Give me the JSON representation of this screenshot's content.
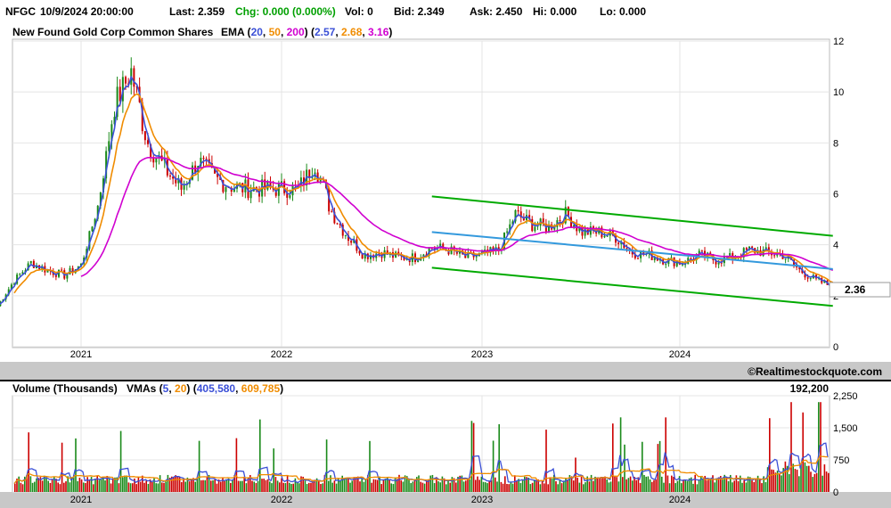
{
  "quote": {
    "symbol": "NFGC",
    "datetime": "10/9/2024 20:00:00",
    "last": "Last: 2.359",
    "chg": "Chg: 0.000 (0.000%)",
    "vol": "Vol: 0",
    "bid": "Bid: 2.349",
    "ask": "Ask: 2.450",
    "hi": "Hi: 0.000",
    "lo": "Lo: 0.000"
  },
  "colors": {
    "up": "#1a8a1a",
    "down": "#cc0000",
    "ema20": "#3a4fd6",
    "ema50": "#f08c00",
    "ema200": "#d000d0",
    "channel_green": "#00aa00",
    "channel_blue": "#3399dd",
    "chg": "#00a000",
    "band": "#c8c8c8"
  },
  "copyright": "©Realtimestockquote.com",
  "price_panel": {
    "title": "New Found Gold Corp Common Shares",
    "ema_prefix": "EMA (",
    "ema_periods": [
      "20",
      "50",
      "200"
    ],
    "ema_values": [
      "2.57",
      "2.68",
      "3.16"
    ],
    "last_price_tag": "2.36"
  },
  "volume_panel": {
    "title": "Volume (Thousands)",
    "vma_label": "VMAs (",
    "vma_periods": [
      "5",
      "20"
    ],
    "vma_values": [
      "405,580",
      "609,785"
    ],
    "last_volume": "192,200"
  },
  "chart_data": [
    {
      "type": "candlestick",
      "title": "New Found Gold Corp Common Shares",
      "ylim": [
        0,
        12
      ],
      "y_ticks": [
        0,
        2,
        4,
        6,
        8,
        10,
        12
      ],
      "x_ticks": [
        "2021",
        "2022",
        "2023",
        "2024"
      ],
      "grid": true,
      "series": [
        {
          "name": "Price (approx. monthly close)",
          "x": [
            "2020-08",
            "2020-09",
            "2020-10",
            "2020-11",
            "2020-12",
            "2021-01",
            "2021-02",
            "2021-03",
            "2021-04",
            "2021-05",
            "2021-06",
            "2021-07",
            "2021-08",
            "2021-09",
            "2021-10",
            "2021-11",
            "2021-12",
            "2022-01",
            "2022-02",
            "2022-03",
            "2022-04",
            "2022-05",
            "2022-06",
            "2022-07",
            "2022-08",
            "2022-09",
            "2022-10",
            "2022-11",
            "2022-12",
            "2023-01",
            "2023-02",
            "2023-03",
            "2023-04",
            "2023-05",
            "2023-06",
            "2023-07",
            "2023-08",
            "2023-09",
            "2023-10",
            "2023-11",
            "2023-12",
            "2024-01",
            "2024-02",
            "2024-03",
            "2024-04",
            "2024-05",
            "2024-06",
            "2024-07",
            "2024-08",
            "2024-09",
            "2024-10"
          ],
          "values": [
            1.6,
            2.6,
            3.3,
            3.0,
            2.8,
            3.2,
            5.5,
            9.5,
            10.8,
            8.0,
            7.0,
            6.2,
            7.3,
            6.6,
            6.3,
            6.2,
            6.2,
            6.2,
            6.2,
            7.2,
            5.3,
            4.3,
            3.6,
            3.7,
            3.5,
            3.5,
            3.9,
            3.8,
            3.5,
            3.6,
            3.8,
            5.2,
            4.8,
            4.7,
            5.2,
            4.5,
            4.5,
            4.3,
            3.7,
            3.6,
            3.4,
            3.3,
            3.6,
            3.4,
            3.5,
            3.8,
            3.7,
            3.6,
            3.0,
            2.6,
            2.36
          ]
        },
        {
          "name": "EMA 20",
          "x": [
            "2024-10"
          ],
          "values": [
            2.57
          ]
        },
        {
          "name": "EMA 50",
          "x": [
            "2024-10"
          ],
          "values": [
            2.68
          ]
        },
        {
          "name": "EMA 200",
          "x": [
            "2024-10"
          ],
          "values": [
            3.16
          ]
        }
      ],
      "annotations": [
        "Descending channel (green) from late 2022 to Oct 2024",
        "Blue regression midline"
      ]
    },
    {
      "type": "bar",
      "title": "Volume (Thousands)",
      "ylim": [
        0,
        2250
      ],
      "y_ticks": [
        0,
        750,
        1500,
        2250
      ],
      "x_ticks": [
        "2021",
        "2022",
        "2023",
        "2024"
      ],
      "series": [
        {
          "name": "Volume (approx. typical)",
          "x": [
            "2021",
            "2022",
            "2023",
            "2024"
          ],
          "values": [
            300,
            250,
            350,
            450
          ]
        },
        {
          "name": "VMA 5",
          "x": [
            "2024-10"
          ],
          "values": [
            405.58
          ]
        },
        {
          "name": "VMA 20",
          "x": [
            "2024-10"
          ],
          "values": [
            609.785
          ]
        }
      ]
    }
  ]
}
